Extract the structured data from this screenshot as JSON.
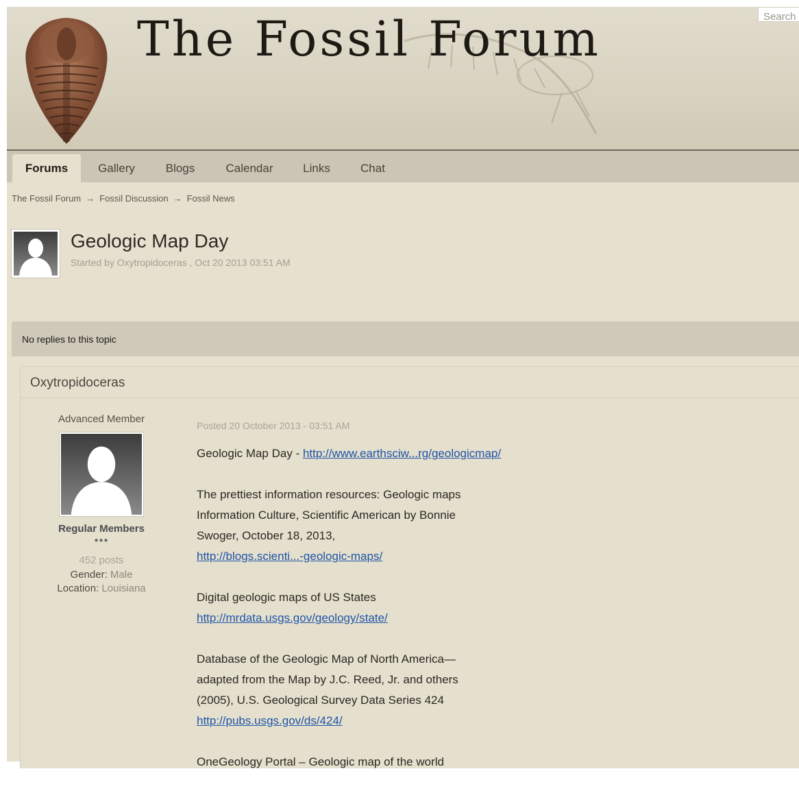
{
  "header": {
    "site_title": "The Fossil Forum",
    "search_placeholder": "Search"
  },
  "nav": {
    "tabs": [
      {
        "label": "Forums",
        "active": true
      },
      {
        "label": "Gallery"
      },
      {
        "label": "Blogs"
      },
      {
        "label": "Calendar"
      },
      {
        "label": "Links"
      },
      {
        "label": "Chat"
      }
    ]
  },
  "breadcrumb": {
    "items": [
      "The Fossil Forum",
      "Fossil Discussion",
      "Fossil News"
    ],
    "separator": "→"
  },
  "topic": {
    "title": "Geologic Map Day",
    "meta": "Started by Oxytropidoceras , Oct 20 2013 03:51 AM"
  },
  "replies_bar": {
    "text": "No replies to this topic"
  },
  "post": {
    "author": "Oxytropidoceras",
    "member_title": "Advanced Member",
    "group": "Regular Members",
    "pips": "●●●",
    "post_count": "452 posts",
    "gender_label": "Gender:",
    "gender_value": "Male",
    "location_label": "Location:",
    "location_value": "Louisiana",
    "posted": "Posted 20 October 2013 - 03:51 AM",
    "body": {
      "p1_text": "Geologic Map Day - ",
      "p1_link": "http://www.earthsciw...rg/geologicmap/",
      "p2_line1": "The prettiest information resources: Geologic maps",
      "p2_line2": "Information Culture, Scientific American by Bonnie",
      "p2_line3": "Swoger, October 18, 2013,",
      "p2_link": "http://blogs.scienti...-geologic-maps/",
      "p3_line1": "Digital geologic maps of US States",
      "p3_link": "http://mrdata.usgs.gov/geology/state/",
      "p4_line1": "Database of the Geologic Map of North America—",
      "p4_line2": "adapted from the Map by J.C. Reed, Jr. and others",
      "p4_line3": "(2005), U.S. Geological Survey Data Series 424",
      "p4_link": "http://pubs.usgs.gov/ds/424/",
      "p5_line1": "OneGeology Portal – Geologic map of the world"
    }
  },
  "colors": {
    "background": "#e7e0ce",
    "navbar": "#cbc5b5",
    "link": "#1f55a8"
  },
  "icons": [
    "trilobite-logo",
    "fossil-skeleton-watermark",
    "default-avatar"
  ]
}
